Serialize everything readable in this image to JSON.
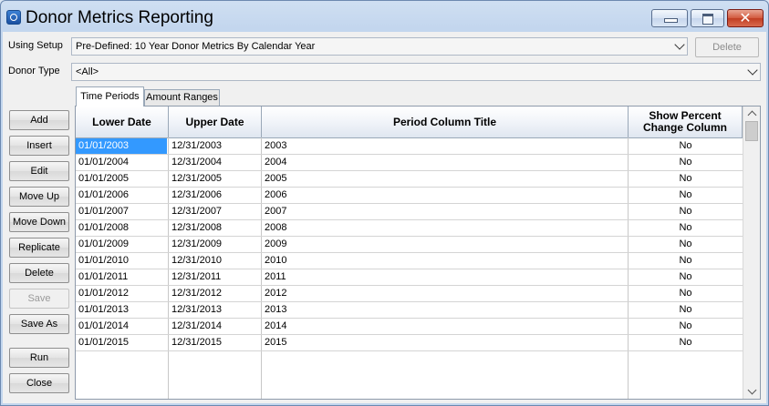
{
  "window": {
    "title": "Donor Metrics Reporting"
  },
  "setup": {
    "label": "Using Setup",
    "value": "Pre-Defined: 10 Year Donor Metrics By Calendar Year",
    "delete_label": "Delete"
  },
  "donor_type": {
    "label": "Donor Type",
    "value": "<All>"
  },
  "tabs": [
    {
      "label": "Time Periods",
      "active": true
    },
    {
      "label": "Amount Ranges",
      "active": false
    }
  ],
  "side_buttons": [
    {
      "label": "Add",
      "enabled": true
    },
    {
      "label": "Insert",
      "enabled": true
    },
    {
      "label": "Edit",
      "enabled": true
    },
    {
      "label": "Move Up",
      "enabled": true
    },
    {
      "label": "Move Down",
      "enabled": true
    },
    {
      "label": "Replicate",
      "enabled": true
    },
    {
      "label": "Delete",
      "enabled": true
    },
    {
      "label": "Save",
      "enabled": false
    },
    {
      "label": "Save As",
      "enabled": true
    },
    {
      "label": "Run",
      "enabled": true
    },
    {
      "label": "Close",
      "enabled": true
    }
  ],
  "table": {
    "columns": [
      "Lower Date",
      "Upper Date",
      "Period Column Title",
      "Show Percent Change Column"
    ],
    "rows": [
      [
        "01/01/2003",
        "12/31/2003",
        "2003",
        "No"
      ],
      [
        "01/01/2004",
        "12/31/2004",
        "2004",
        "No"
      ],
      [
        "01/01/2005",
        "12/31/2005",
        "2005",
        "No"
      ],
      [
        "01/01/2006",
        "12/31/2006",
        "2006",
        "No"
      ],
      [
        "01/01/2007",
        "12/31/2007",
        "2007",
        "No"
      ],
      [
        "01/01/2008",
        "12/31/2008",
        "2008",
        "No"
      ],
      [
        "01/01/2009",
        "12/31/2009",
        "2009",
        "No"
      ],
      [
        "01/01/2010",
        "12/31/2010",
        "2010",
        "No"
      ],
      [
        "01/01/2011",
        "12/31/2011",
        "2011",
        "No"
      ],
      [
        "01/01/2012",
        "12/31/2012",
        "2012",
        "No"
      ],
      [
        "01/01/2013",
        "12/31/2013",
        "2013",
        "No"
      ],
      [
        "01/01/2014",
        "12/31/2014",
        "2014",
        "No"
      ],
      [
        "01/01/2015",
        "12/31/2015",
        "2015",
        "No"
      ]
    ]
  },
  "colors": {
    "selection": "#3399ff",
    "titlebar": "#cfdff2",
    "close_button": "#c13d22"
  }
}
